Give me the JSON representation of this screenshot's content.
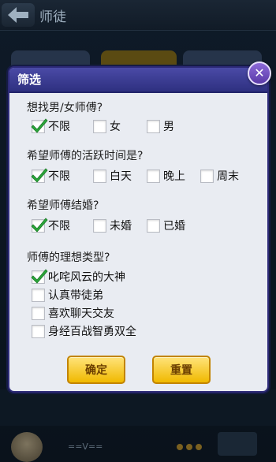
{
  "app": {
    "title": "师徒"
  },
  "background": {
    "footer_text": "==V=="
  },
  "dialog": {
    "title": "筛选",
    "sections": [
      {
        "question": "想找男/女师傅?",
        "options": [
          {
            "label": "不限",
            "checked": true
          },
          {
            "label": "女",
            "checked": false
          },
          {
            "label": "男",
            "checked": false
          }
        ]
      },
      {
        "question": "希望师傅的活跃时间是?",
        "options": [
          {
            "label": "不限",
            "checked": true
          },
          {
            "label": "白天",
            "checked": false
          },
          {
            "label": "晚上",
            "checked": false
          },
          {
            "label": "周末",
            "checked": false
          }
        ]
      },
      {
        "question": "希望师傅结婚?",
        "options": [
          {
            "label": "不限",
            "checked": true
          },
          {
            "label": "未婚",
            "checked": false
          },
          {
            "label": "已婚",
            "checked": false
          }
        ]
      },
      {
        "question": "师傅的理想类型?",
        "options": [
          {
            "label": "叱咤风云的大神",
            "checked": true
          },
          {
            "label": "认真带徒弟",
            "checked": false
          },
          {
            "label": "喜欢聊天交友",
            "checked": false
          },
          {
            "label": "身经百战智勇双全",
            "checked": false
          }
        ]
      }
    ],
    "confirm_label": "确定",
    "reset_label": "重置"
  },
  "colors": {
    "accent": "#f0b900",
    "header": "#3a3a96",
    "check": "#2aa63a"
  }
}
